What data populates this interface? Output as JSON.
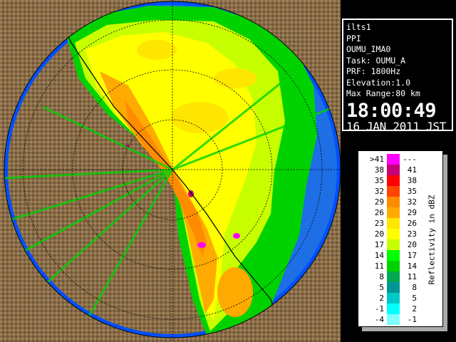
{
  "info": {
    "radar_name": "ilts1",
    "scan_type": "PPI",
    "site": "OUMU_IMA0",
    "task": "Task: OUMU_A",
    "prf": "PRF: 1800Hz",
    "elevation": "Elevation:1.0",
    "max_range": "Max Range:80 km",
    "time": "18:00:49",
    "date": "16 JAN 2011 JST"
  },
  "legend": {
    "title": "Reflectivity in dBZ",
    "rows": [
      {
        "lo": ">41",
        "hi": "---",
        "color": "#ff00ff"
      },
      {
        "lo": "38",
        "hi": "41",
        "color": "#c80078"
      },
      {
        "lo": "35",
        "hi": "38",
        "color": "#ff0000"
      },
      {
        "lo": "32",
        "hi": "35",
        "color": "#ff4600"
      },
      {
        "lo": "29",
        "hi": "32",
        "color": "#ff8c00"
      },
      {
        "lo": "26",
        "hi": "29",
        "color": "#ffaa00"
      },
      {
        "lo": "23",
        "hi": "26",
        "color": "#ffe600"
      },
      {
        "lo": "20",
        "hi": "23",
        "color": "#ffff00"
      },
      {
        "lo": "17",
        "hi": "20",
        "color": "#c8ff00"
      },
      {
        "lo": "14",
        "hi": "17",
        "color": "#00ff00"
      },
      {
        "lo": "11",
        "hi": "14",
        "color": "#00d200"
      },
      {
        "lo": "8",
        "hi": "11",
        "color": "#00aa50"
      },
      {
        "lo": "5",
        "hi": "8",
        "color": "#009696"
      },
      {
        "lo": "2",
        "hi": "5",
        "color": "#00c8c8"
      },
      {
        "lo": "-1",
        "hi": "2",
        "color": "#00ffff"
      },
      {
        "lo": "-4",
        "hi": "-1",
        "color": "#7fffff"
      }
    ]
  },
  "colors": {
    "background": "#000000",
    "sea": "#1e6ee6",
    "sea_edge": "#0050ff",
    "land": "#8c6e46"
  }
}
